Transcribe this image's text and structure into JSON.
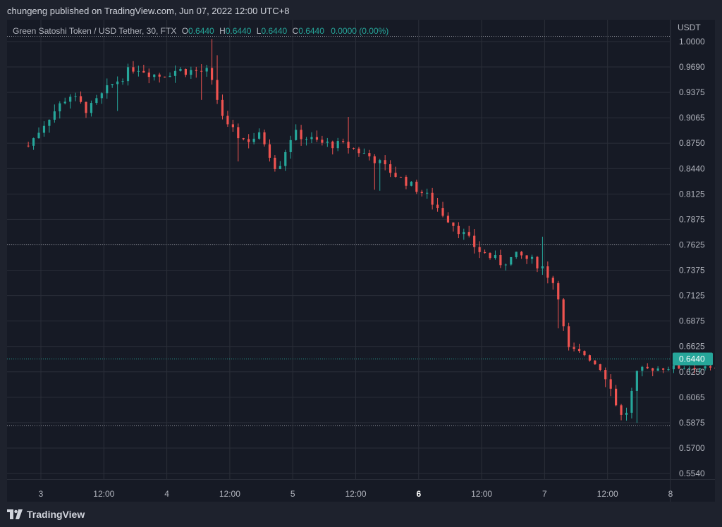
{
  "header": {
    "publish_text": "chungeng published on TradingView.com, Jun 07, 2022 12:00 UTC+8"
  },
  "legend": {
    "symbol": "Green Satoshi Token / USD Tether, 30, FTX",
    "o_label": "O",
    "o_value": "0.6440",
    "h_label": "H",
    "h_value": "0.6440",
    "l_label": "L",
    "l_value": "0.6440",
    "c_label": "C",
    "c_value": "0.6440",
    "change": "0.0000 (0.00%)"
  },
  "footer": {
    "brand": "TradingView"
  },
  "colors": {
    "up": "#26a69a",
    "down": "#ef5350",
    "grid": "#2a2e39",
    "text": "#b2b5be",
    "last_price_badge": "#26a69a"
  },
  "chart_data": {
    "type": "candlestick",
    "symbol": "Green Satoshi Token / USD Tether",
    "interval": "30",
    "exchange": "FTX",
    "currency_label": "USDT",
    "y_ticks": [
      "1.0000",
      "0.9690",
      "0.9375",
      "0.9065",
      "0.8750",
      "0.8440",
      "0.8125",
      "0.7875",
      "0.7625",
      "0.7375",
      "0.7125",
      "0.6875",
      "0.6625",
      "0.6250",
      "0.6065",
      "0.5875",
      "0.5700",
      "0.5540"
    ],
    "x_ticks": [
      {
        "label": "3",
        "bold": false
      },
      {
        "label": "12:00",
        "bold": false
      },
      {
        "label": "4",
        "bold": false
      },
      {
        "label": "12:00",
        "bold": false
      },
      {
        "label": "5",
        "bold": false
      },
      {
        "label": "12:00",
        "bold": false
      },
      {
        "label": "6",
        "bold": true
      },
      {
        "label": "12:00",
        "bold": false
      },
      {
        "label": "7",
        "bold": false
      },
      {
        "label": "12:00",
        "bold": false
      },
      {
        "label": "8",
        "bold": false
      }
    ],
    "last_price": "0.6440",
    "horizontal_lines": [
      1.0065,
      0.7625,
      0.644,
      0.5855
    ],
    "close_path": [
      {
        "t": 0.0,
        "p": 0.872
      },
      {
        "t": 0.6,
        "p": 0.905
      },
      {
        "t": 1.3,
        "p": 0.935
      },
      {
        "t": 1.9,
        "p": 0.915
      },
      {
        "t": 2.6,
        "p": 0.945
      },
      {
        "t": 3.4,
        "p": 0.97
      },
      {
        "t": 4.1,
        "p": 0.958
      },
      {
        "t": 4.7,
        "p": 0.965
      },
      {
        "t": 5.7,
        "p": 0.963
      },
      {
        "t": 6.3,
        "p": 0.895
      },
      {
        "t": 6.9,
        "p": 0.878
      },
      {
        "t": 7.4,
        "p": 0.885
      },
      {
        "t": 7.9,
        "p": 0.842
      },
      {
        "t": 8.4,
        "p": 0.888
      },
      {
        "t": 9.3,
        "p": 0.875
      },
      {
        "t": 10.1,
        "p": 0.872
      },
      {
        "t": 10.9,
        "p": 0.858
      },
      {
        "t": 11.7,
        "p": 0.835
      },
      {
        "t": 12.6,
        "p": 0.812
      },
      {
        "t": 13.6,
        "p": 0.78
      },
      {
        "t": 14.3,
        "p": 0.757
      },
      {
        "t": 15.0,
        "p": 0.745
      },
      {
        "t": 15.6,
        "p": 0.752
      },
      {
        "t": 16.3,
        "p": 0.742
      },
      {
        "t": 16.8,
        "p": 0.72
      },
      {
        "t": 17.1,
        "p": 0.66
      },
      {
        "t": 17.7,
        "p": 0.65
      },
      {
        "t": 18.3,
        "p": 0.625
      },
      {
        "t": 18.9,
        "p": 0.588
      },
      {
        "t": 19.4,
        "p": 0.628
      },
      {
        "t": 20.2,
        "p": 0.631
      },
      {
        "t": 21.1,
        "p": 0.632
      },
      {
        "t": 22.0,
        "p": 0.627
      },
      {
        "t": 22.8,
        "p": 0.598
      },
      {
        "t": 23.5,
        "p": 0.605
      },
      {
        "t": 24.2,
        "p": 0.64
      },
      {
        "t": 24.8,
        "p": 0.672
      },
      {
        "t": 25.6,
        "p": 0.662
      },
      {
        "t": 26.5,
        "p": 0.66
      },
      {
        "t": 27.3,
        "p": 0.655
      },
      {
        "t": 28.2,
        "p": 0.651
      },
      {
        "t": 28.8,
        "p": 0.648
      },
      {
        "t": 29.2,
        "p": 0.612
      },
      {
        "t": 29.6,
        "p": 0.61
      },
      {
        "t": 29.95,
        "p": 0.644
      }
    ]
  }
}
